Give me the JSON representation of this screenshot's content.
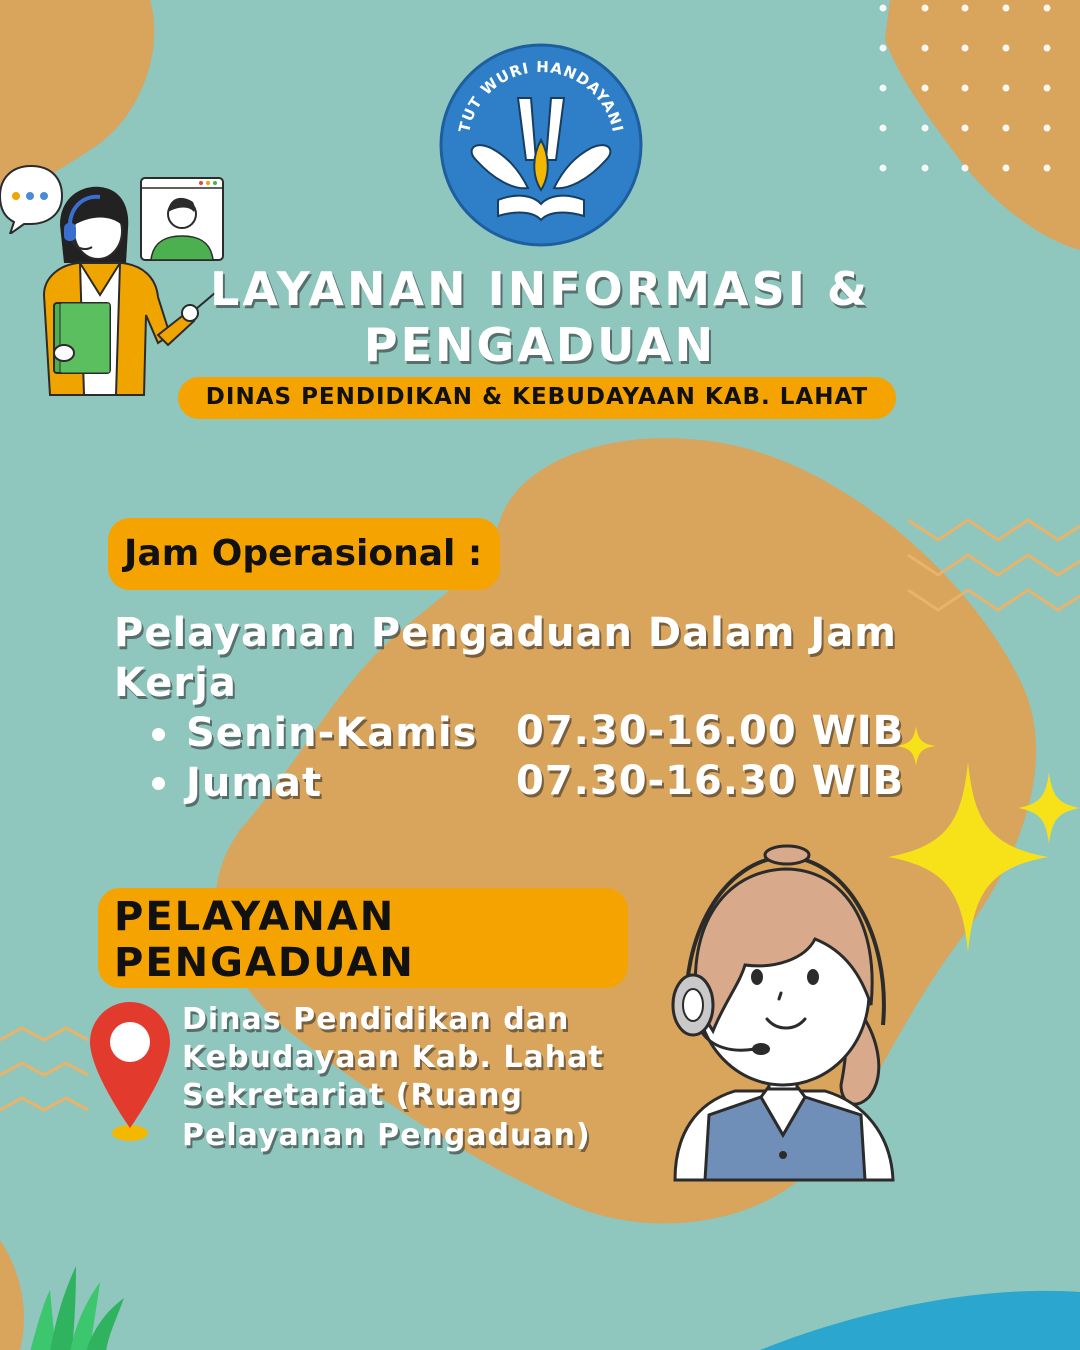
{
  "logo": {
    "motto": "TUT WURI HANDAYANI"
  },
  "header": {
    "title_line1": "LAYANAN INFORMASI &",
    "title_line2": "PENGADUAN",
    "agency": "DINAS PENDIDIKAN & KEBUDAYAAN KAB. LAHAT"
  },
  "hours": {
    "label": "Jam Operasional :",
    "subtitle_line1": "Pelayanan Pengaduan Dalam Jam",
    "subtitle_line2": "Kerja",
    "schedule": [
      {
        "day": "Senin-Kamis",
        "time": "07.30-16.00 WIB"
      },
      {
        "day": "Jumat",
        "time": "07.30-16.30 WIB"
      }
    ]
  },
  "complaint": {
    "heading_line1": "PELAYANAN",
    "heading_line2": "PENGADUAN",
    "address_lines": [
      "Dinas Pendidikan dan",
      "Kebudayaan Kab. Lahat",
      "Sekretariat (Ruang",
      "Pelayanan Pengaduan)"
    ]
  },
  "colors": {
    "background": "#8fc6be",
    "blob": "#d9a45c",
    "accent_orange": "#f5a300",
    "logo_blue": "#2f7fc8",
    "sparkle": "#f7e21a",
    "pin_red": "#e23b2e"
  },
  "icons": [
    "emblem-logo",
    "chat-bubble-icon",
    "video-call-icon",
    "location-pin-icon",
    "sparkle-icon",
    "plant-icon"
  ]
}
